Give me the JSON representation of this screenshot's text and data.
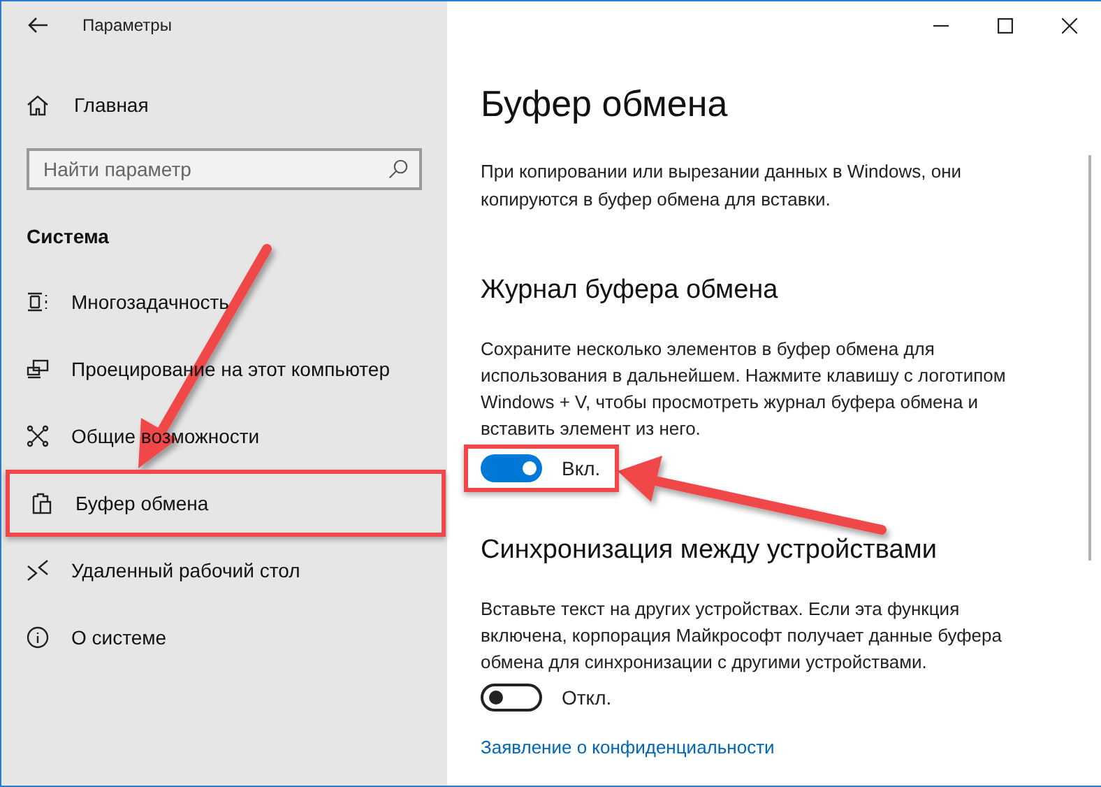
{
  "window": {
    "title": "Параметры"
  },
  "sidebar": {
    "home": "Главная",
    "search": {
      "placeholder": "Найти параметр"
    },
    "section": "Система",
    "items": [
      {
        "label": "Многозадачность",
        "selected": false
      },
      {
        "label": "Проецирование на этот компьютер",
        "selected": false
      },
      {
        "label": "Общие возможности",
        "selected": false
      },
      {
        "label": "Буфер обмена",
        "selected": true
      },
      {
        "label": "Удаленный рабочий стол",
        "selected": false
      },
      {
        "label": "О системе",
        "selected": false
      }
    ]
  },
  "content": {
    "title": "Буфер обмена",
    "intro": "При копировании или вырезании данных в Windows, они копируются в буфер обмена для вставки.",
    "sections": [
      {
        "heading": "Журнал буфера обмена",
        "text": "Сохраните несколько элементов в буфер обмена для использования в дальнейшем. Нажмите клавишу с логотипом Windows + V, чтобы просмотреть журнал буфера обмена и вставить элемент из него.",
        "toggle": {
          "on": true,
          "label": "Вкл."
        }
      },
      {
        "heading": "Синхронизация между устройствами",
        "text": "Вставьте текст на других устройствах. Если эта функция включена, корпорация Майкрософт получает данные буфера обмена для синхронизации с другими устройствами.",
        "toggle": {
          "on": false,
          "label": "Откл."
        }
      }
    ],
    "link": "Заявление о конфиденциальности"
  }
}
